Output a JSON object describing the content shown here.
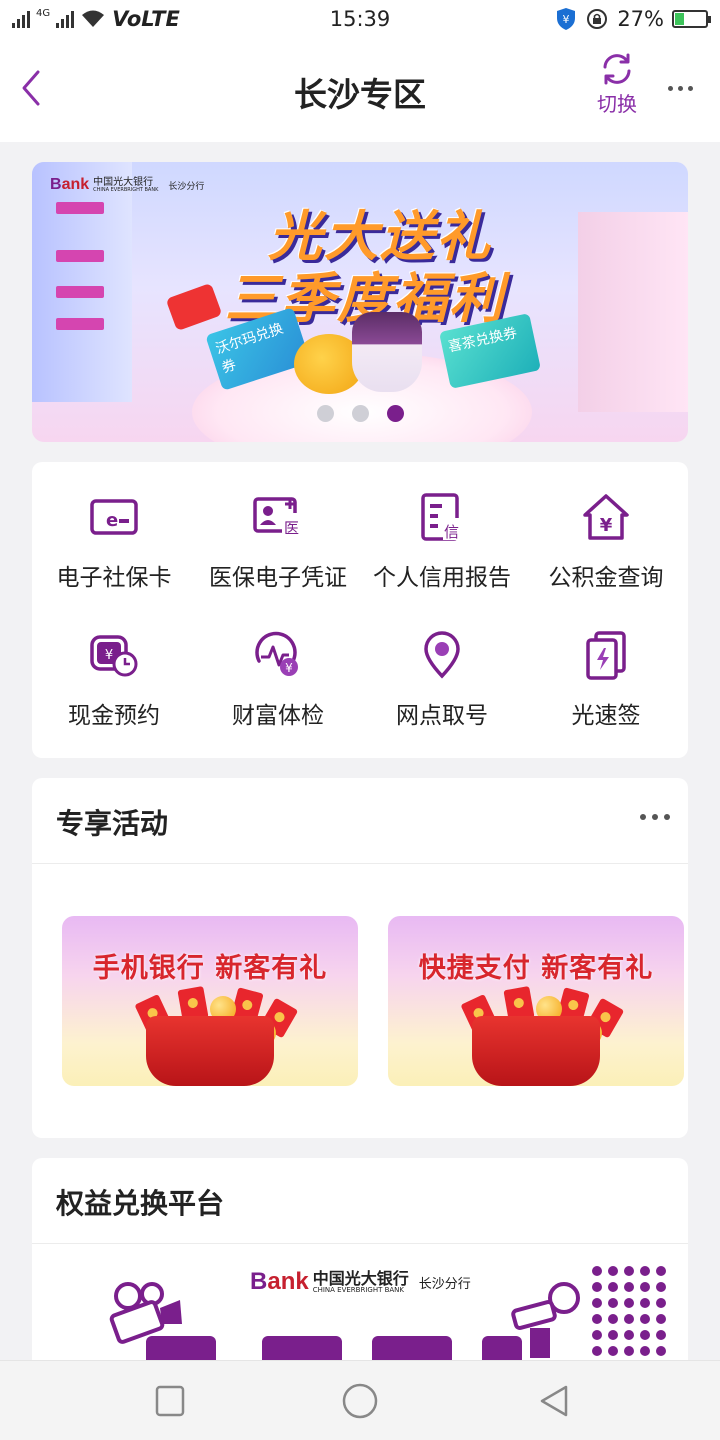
{
  "status_bar": {
    "network": "4G",
    "carrier_tag": "VoLTE",
    "time": "15:39",
    "battery": "27%",
    "battery_level": 0.27
  },
  "header": {
    "title": "长沙专区",
    "switch_label": "切换"
  },
  "banner": {
    "bank_name_cn": "中国光大银行",
    "bank_name_en": "CHINA EVERBRIGHT BANK",
    "branch": "长沙分行",
    "headline_1": "光大送礼",
    "headline_2": "三季度福利",
    "coupon_1": "沃尔玛兑换券",
    "coupon_2": "喜茶兑换券",
    "slide_count": 3,
    "active_slide": 3
  },
  "services": [
    {
      "label": "电子社保卡",
      "icon": "e-card-icon"
    },
    {
      "label": "医保电子凭证",
      "icon": "medical-id-icon"
    },
    {
      "label": "个人信用报告",
      "icon": "credit-report-icon"
    },
    {
      "label": "公积金查询",
      "icon": "housing-fund-icon"
    },
    {
      "label": "现金预约",
      "icon": "cash-appointment-icon"
    },
    {
      "label": "财富体检",
      "icon": "wealth-checkup-icon"
    },
    {
      "label": "网点取号",
      "icon": "location-pin-icon"
    },
    {
      "label": "光速签",
      "icon": "quick-sign-icon"
    }
  ],
  "activities": {
    "title": "专享活动",
    "items": [
      {
        "title": "手机银行 新客有礼"
      },
      {
        "title": "快捷支付 新客有礼"
      }
    ]
  },
  "rights": {
    "title": "权益兑换平台",
    "bank_name_cn": "中国光大银行",
    "bank_name_en": "CHINA EVERBRIGHT BANK",
    "branch": "长沙分行"
  },
  "colors": {
    "brand_purple": "#7a1f8c",
    "accent_purple": "#8a2fa8",
    "promo_red": "#d8262d"
  }
}
